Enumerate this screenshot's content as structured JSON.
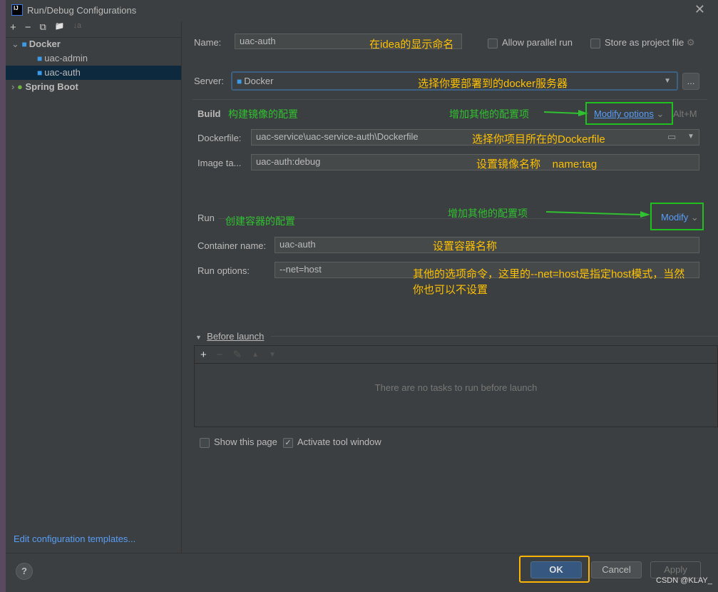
{
  "window": {
    "title": "Run/Debug Configurations",
    "logo": "IJ"
  },
  "sidebar": {
    "toolbar": [
      "+",
      "−",
      "⧉",
      "📁",
      "↓a"
    ],
    "tree": [
      {
        "label": "Docker",
        "expanded": true
      },
      {
        "label": "uac-admin"
      },
      {
        "label": "uac-auth",
        "selected": true
      },
      {
        "label": "Spring Boot",
        "expanded": false
      }
    ],
    "footer_link": "Edit configuration templates..."
  },
  "form": {
    "name_label": "Name:",
    "name_value": "uac-auth",
    "name_note": "在idea的显示命名",
    "allow_parallel": "Allow parallel run",
    "store_project": "Store as project file",
    "server_label": "Server:",
    "server_value": "Docker",
    "server_note": "选择你要部署到的docker服务器",
    "more": "...",
    "build_label": "Build",
    "build_note": "构建镜像的配置",
    "modify_note": "增加其他的配置项",
    "modify_options": "Modify options",
    "modify_shortcut": "Alt+M",
    "dockerfile_label": "Dockerfile:",
    "dockerfile_value": "uac-service\\uac-service-auth\\Dockerfile",
    "dockerfile_note": "选择你项目所在的Dockerfile",
    "image_label": "Image ta...",
    "image_value": "uac-auth:debug",
    "image_note": "设置镜像名称    name:tag",
    "run_label": "Run",
    "run_note": "创建容器的配置",
    "run_modify_note": "增加其他的配置项",
    "run_modify": "Modify",
    "container_label": "Container name:",
    "container_value": "uac-auth",
    "container_note": "设置容器名称",
    "runopt_label": "Run options:",
    "runopt_value": "--net=host",
    "runopt_note1": "其他的选项命令，这里的--net=host是指定host模式，当然",
    "runopt_note2": "你也可以不设置",
    "before_launch": "Before launch",
    "empty_tasks": "There are no tasks to run before launch",
    "show_page": "Show this page",
    "activate_tool": "Activate tool window"
  },
  "buttons": {
    "help": "?",
    "ok": "OK",
    "cancel": "Cancel",
    "apply": "Apply"
  },
  "watermark": "CSDN @KLAY_",
  "colors": {
    "annotation_text": "#ffc000",
    "annotation_box_green": "#1fbf1f",
    "ok_box": "#ffb400",
    "link": "#589df6"
  }
}
